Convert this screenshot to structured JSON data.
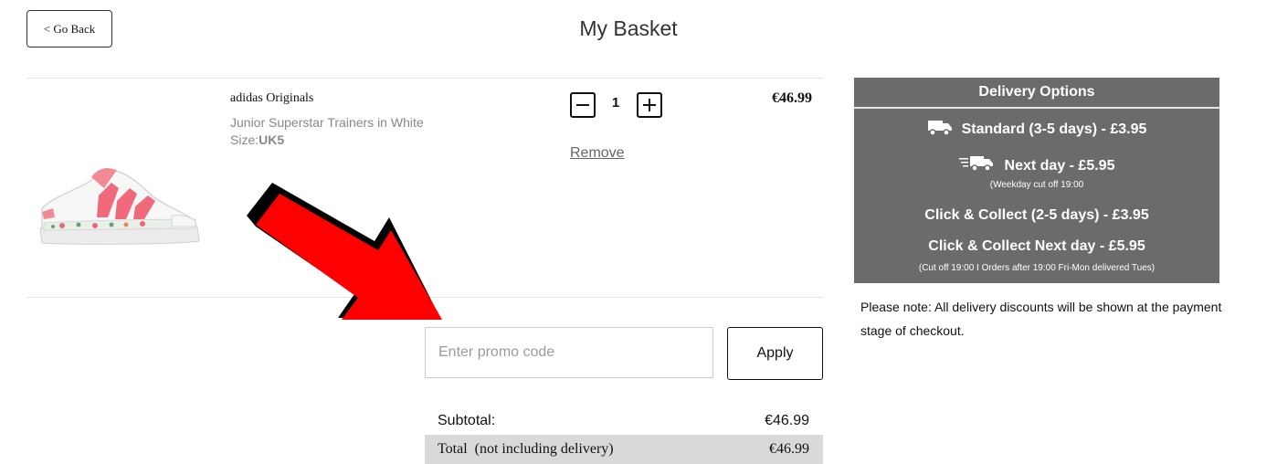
{
  "header": {
    "go_back_label": "< Go Back",
    "title": "My Basket"
  },
  "basket_item": {
    "image_alt": "Junior Superstar Trainers in White",
    "brand": "adidas Originals",
    "name": "Junior Superstar Trainers in White",
    "size_label": "Size:",
    "size_value": "UK5",
    "quantity": "1",
    "remove_label": "Remove",
    "price": "€46.99"
  },
  "promo": {
    "placeholder": "Enter promo code",
    "value": "",
    "apply_label": "Apply"
  },
  "summary": {
    "subtotal_label": "Subtotal:",
    "subtotal_value": "€46.99",
    "total_label": "Total  (not including delivery)",
    "total_value": "€46.99"
  },
  "delivery": {
    "title": "Delivery Options",
    "options": [
      {
        "label": "Standard (3-5 days) - £3.95",
        "icon": "delivery-truck-icon",
        "note": ""
      },
      {
        "label": "Next day - £5.95",
        "icon": "fast-delivery-truck-icon",
        "note": "(Weekday cut off 19:00"
      },
      {
        "label": "Click & Collect (2-5 days) - £3.95",
        "icon": "",
        "note": ""
      },
      {
        "label": "Click & Collect Next day - £5.95",
        "icon": "",
        "note": "(Cut off 19:00 I Orders after 19:00 Fri-Mon delivered Tues)"
      }
    ],
    "note": "Please note: All delivery discounts will be shown at the payment stage of checkout."
  },
  "colors": {
    "panel_bg": "#6b6b6b",
    "arrow": "#ff0000",
    "total_row_bg": "#d9d9d9"
  }
}
